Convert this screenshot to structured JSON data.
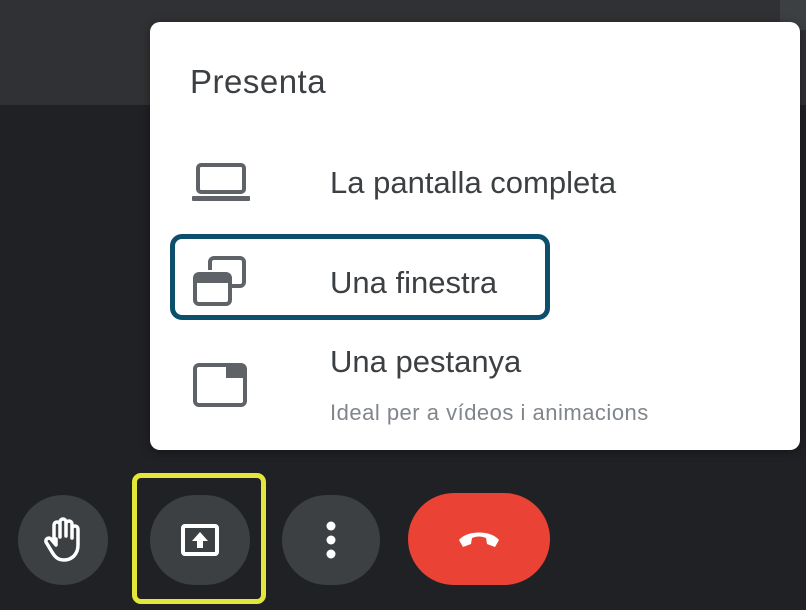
{
  "menu": {
    "title": "Presenta",
    "items": [
      {
        "label": "La pantalla completa",
        "icon": "laptop-icon"
      },
      {
        "label": "Una finestra",
        "icon": "window-icon",
        "focused": true
      },
      {
        "label": "Una pestanya",
        "description": "Ideal per a vídeos i animacions",
        "icon": "tab-icon"
      }
    ]
  },
  "controls": [
    {
      "name": "raise-hand",
      "icon": "hand-icon"
    },
    {
      "name": "present-now",
      "icon": "present-screen-icon",
      "highlighted": true
    },
    {
      "name": "more-options",
      "icon": "more-vert-icon"
    },
    {
      "name": "hang-up",
      "icon": "phone-hangup-icon"
    }
  ],
  "colors": {
    "background": "#202124",
    "control_button": "#3c4043",
    "hangup": "#ea4335",
    "focus_ring": "#0b4f6c",
    "highlight": "#e2e73a",
    "menu_text": "#3c4043",
    "menu_secondary_text": "#80868b"
  }
}
